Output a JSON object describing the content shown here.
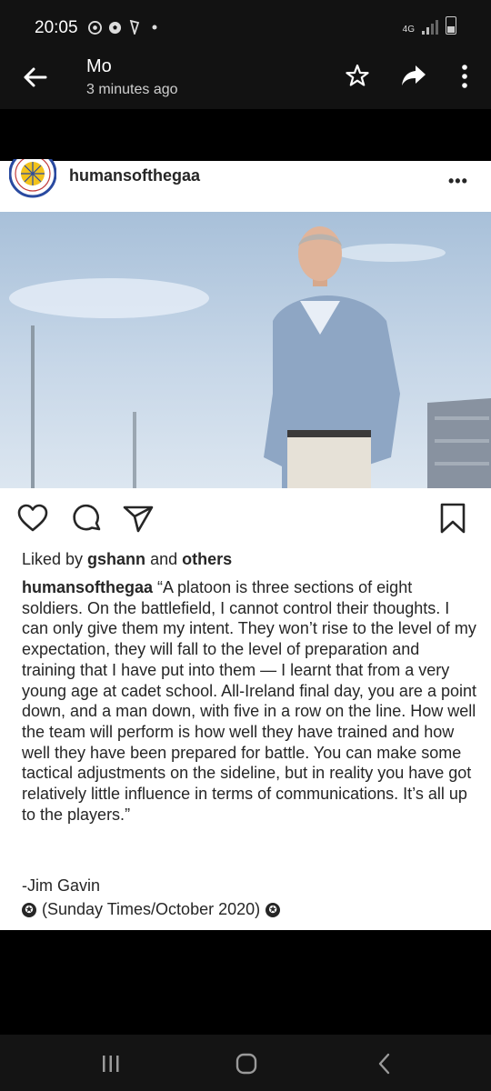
{
  "status_bar": {
    "time": "20:05",
    "network": "4G",
    "icons": [
      "chrome-icon",
      "football-icon",
      "harp-icon",
      "dot-icon"
    ]
  },
  "app_bar": {
    "sender": "Mo",
    "timestamp": "3 minutes ago"
  },
  "post": {
    "username": "humansofthegaa",
    "more": "•••",
    "likes": {
      "prefix": "Liked by ",
      "user": "gshann",
      "middle": " and ",
      "others": "others"
    },
    "caption": {
      "username": "humansofthegaa",
      "text": " “A platoon is three sections of eight soldiers. On the battlefield, I cannot control their thoughts. I can only give them my intent. They won’t rise to the level of my expectation, they will fall to the level of preparation and training that I have put into them — I learnt that from a very young age at cadet school. All-Ireland final day, you are a point down, and a man down, with five in a row on the line. How well the team will perform is how well they have trained and how well they have been prepared for battle. You can make some tactical adjustments on the sideline, but in reality you have got relatively little influence in terms of communications. It’s all up to the players.”"
    },
    "author": "-Jim Gavin",
    "source": "(Sunday Times/October 2020)"
  },
  "colors": {
    "bar_bg": "#121212",
    "text": "#262626",
    "sky": "#b9cde2"
  }
}
